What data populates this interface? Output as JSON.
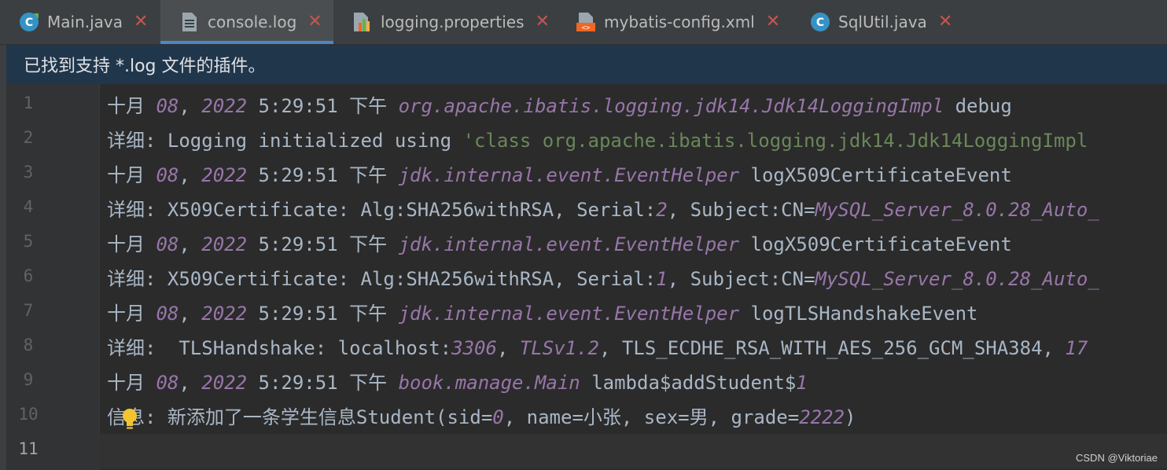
{
  "tabs": [
    {
      "label": "Main.java",
      "icon": "java-class-icon",
      "active": false
    },
    {
      "label": "console.log",
      "icon": "text-file-icon",
      "active": true
    },
    {
      "label": "logging.properties",
      "icon": "properties-file-icon",
      "active": false
    },
    {
      "label": "mybatis-config.xml",
      "icon": "xml-file-icon",
      "active": false
    },
    {
      "label": "SqlUtil.java",
      "icon": "java-class-icon",
      "active": false
    }
  ],
  "close_symbol": "✕",
  "infobar": {
    "text": "已找到支持 *.log 文件的插件。"
  },
  "line_numbers": [
    "1",
    "2",
    "3",
    "4",
    "5",
    "6",
    "7",
    "8",
    "9",
    "10",
    "11"
  ],
  "lines": [
    {
      "a": "十月 ",
      "b": "08",
      "c": ", ",
      "d": "2022",
      "e": " 5:29:51 下午 ",
      "f": "org.apache.ibatis.logging.jdk14.Jdk14LoggingImpl",
      "g": " debug"
    },
    {
      "a": "详细: Logging initialized using ",
      "b": "'class org.apache.ibatis.logging.jdk14.Jdk14LoggingImpl"
    },
    {
      "a": "十月 ",
      "b": "08",
      "c": ", ",
      "d": "2022",
      "e": " 5:29:51 下午 ",
      "f": "jdk.internal.event.EventHelper",
      "g": " logX509CertificateEvent"
    },
    {
      "a": "详细: X509Certificate: Alg:SHA256withRSA, Serial:",
      "b": "2",
      "c": ", Subject:CN=",
      "d": "MySQL_Server_8.0.28_Auto_"
    },
    {
      "a": "十月 ",
      "b": "08",
      "c": ", ",
      "d": "2022",
      "e": " 5:29:51 下午 ",
      "f": "jdk.internal.event.EventHelper",
      "g": " logX509CertificateEvent"
    },
    {
      "a": "详细: X509Certificate: Alg:SHA256withRSA, Serial:",
      "b": "1",
      "c": ", Subject:CN=",
      "d": "MySQL_Server_8.0.28_Auto_"
    },
    {
      "a": "十月 ",
      "b": "08",
      "c": ", ",
      "d": "2022",
      "e": " 5:29:51 下午 ",
      "f": "jdk.internal.event.EventHelper",
      "g": " logTLSHandshakeEvent"
    },
    {
      "a": "详细:  TLSHandshake: localhost:",
      "b": "3306",
      "c": ", ",
      "d": "TLSv1.2",
      "e": ", TLS_ECDHE_RSA_WITH_AES_256_GCM_SHA384, ",
      "f": "17"
    },
    {
      "a": "十月 ",
      "b": "08",
      "c": ", ",
      "d": "2022",
      "e": " 5:29:51 下午 ",
      "f": "book.manage.Main",
      "g": " lambda$addStudent$",
      "h": "1"
    },
    {
      "a": "信息: 新添加了一条学生信息Student(sid=",
      "b": "0",
      "c": ", name=小张, sex=男, grade=",
      "d": "2222",
      "e": ")"
    },
    {
      "a": ""
    }
  ],
  "watermark": "CSDN @Viktoriae",
  "colors": {
    "accent": "#4a88c7",
    "close": "#c75450",
    "italic_purple": "#9876aa",
    "string_green": "#6a8759",
    "infobar_bg": "#20364b"
  }
}
